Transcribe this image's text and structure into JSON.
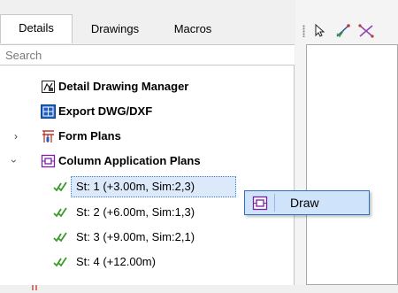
{
  "tabs": [
    {
      "label": "Details",
      "active": true
    },
    {
      "label": "Drawings",
      "active": false
    },
    {
      "label": "Macros",
      "active": false
    }
  ],
  "search": {
    "placeholder": "Search"
  },
  "tree": {
    "items": [
      {
        "label": "Detail Drawing Manager",
        "icon": "detail-drawing-manager-icon",
        "bold": true
      },
      {
        "label": "Export DWG/DXF",
        "icon": "export-dwg-icon",
        "bold": true
      },
      {
        "label": "Form Plans",
        "icon": "form-plans-icon",
        "bold": true,
        "expanded": false
      },
      {
        "label": "Column Application Plans",
        "icon": "column-plans-icon",
        "bold": true,
        "expanded": true
      },
      {
        "label": "St: 1 (+3.00m, Sim:2,3)",
        "icon": "checkmark-icon",
        "selected": true
      },
      {
        "label": "St: 2 (+6.00m, Sim:1,3)",
        "icon": "checkmark-icon"
      },
      {
        "label": "St: 3 (+9.00m, Sim:2,1)",
        "icon": "checkmark-icon"
      },
      {
        "label": "St: 4 (+12.00m)",
        "icon": "checkmark-icon"
      }
    ]
  },
  "context_menu": {
    "items": [
      {
        "label": "Draw",
        "icon": "draw-icon"
      }
    ]
  },
  "colors": {
    "accent": "#2f6fc0",
    "selection": "#dbe9fb",
    "check": "#3a9a2a"
  }
}
